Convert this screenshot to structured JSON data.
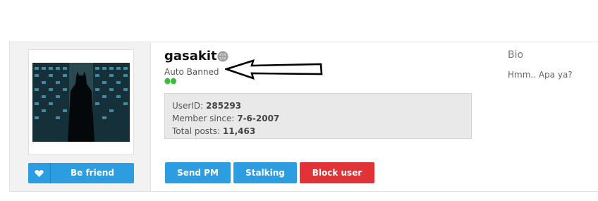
{
  "profile": {
    "username": "gasakit",
    "usertitle": "Auto Banned",
    "status_icon": "globe-icon",
    "reputation_dots_color": "#3dbd3d"
  },
  "stats": {
    "userid_label": "UserID:",
    "userid_value": "285293",
    "member_since_label": "Member since:",
    "member_since_value": "7-6-2007",
    "total_posts_label": "Total posts:",
    "total_posts_value": "11,463"
  },
  "actions": {
    "be_friend_label": "Be friend",
    "be_friend_icon": "heart-icon",
    "send_pm_label": "Send PM",
    "stalking_label": "Stalking",
    "block_user_label": "Block user"
  },
  "bio": {
    "title": "Bio",
    "text": "Hmm.. Apa ya?"
  },
  "colors": {
    "primary_button": "#2d9de2",
    "danger_button": "#e13237",
    "stats_box_bg": "#e9e9e9"
  }
}
